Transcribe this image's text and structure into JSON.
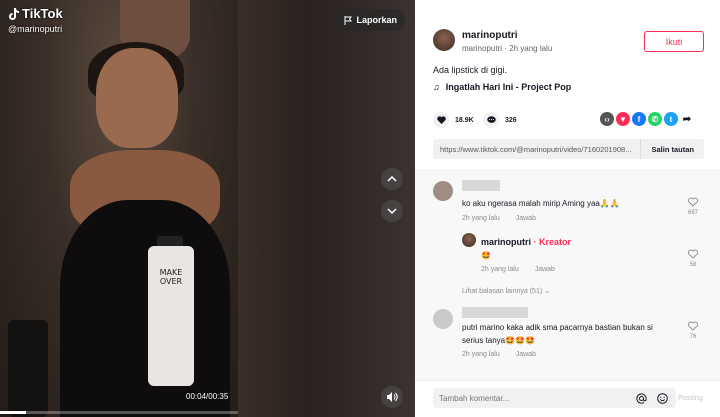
{
  "video": {
    "brand": "TikTok",
    "handle": "@marinoputri",
    "report_label": "Laporkan",
    "timecode": "00:04/00:35",
    "progress_fraction": 0.11,
    "bottle_text": "MAKE OVER"
  },
  "author": {
    "username": "marinoputri",
    "subtitle": "marinoputri · 2h yang lalu",
    "follow_label": "Ikuti"
  },
  "post": {
    "caption": "Ada lipstick di gigi.",
    "music": "Ingatlah Hari Ini - Project Pop",
    "likes": "18.9K",
    "comments": "326",
    "link": "https://www.tiktok.com/@marinoputri/video/7160201908...",
    "copy_label": "Salin tautan"
  },
  "share_icons": [
    {
      "name": "embed-icon",
      "color": "#555555",
      "glyph": "‹›"
    },
    {
      "name": "send-icon",
      "color": "#fe2c55",
      "glyph": "▼"
    },
    {
      "name": "facebook-icon",
      "color": "#1877f2",
      "glyph": "f"
    },
    {
      "name": "whatsapp-icon",
      "color": "#25d366",
      "glyph": "✆"
    },
    {
      "name": "twitter-icon",
      "color": "#1da1f2",
      "glyph": "t"
    },
    {
      "name": "share-arrow-icon",
      "color": "#161823",
      "glyph": "➦"
    }
  ],
  "comments": [
    {
      "text": "ko aku ngerasa malah mirip Aming yaa🙏🙏",
      "time": "2h yang lalu",
      "reply": "Jawab",
      "likes": "697"
    },
    {
      "author": "marinoputri",
      "tag": "· Kreator",
      "text": "🤩",
      "time": "2h yang lalu",
      "reply": "Jawab",
      "likes": "58"
    },
    {
      "more_replies": "Lihat balasan lainnya (51)"
    },
    {
      "text_line1": "putri marino kaka adik sma pacarnya bastian bukan si",
      "text_line2": "serius tanya🤩🤩🤩",
      "time": "2h yang lalu",
      "reply": "Jawab",
      "likes": "76"
    }
  ],
  "composer": {
    "placeholder": "Tambah komentar...",
    "post_label": "Posting"
  }
}
